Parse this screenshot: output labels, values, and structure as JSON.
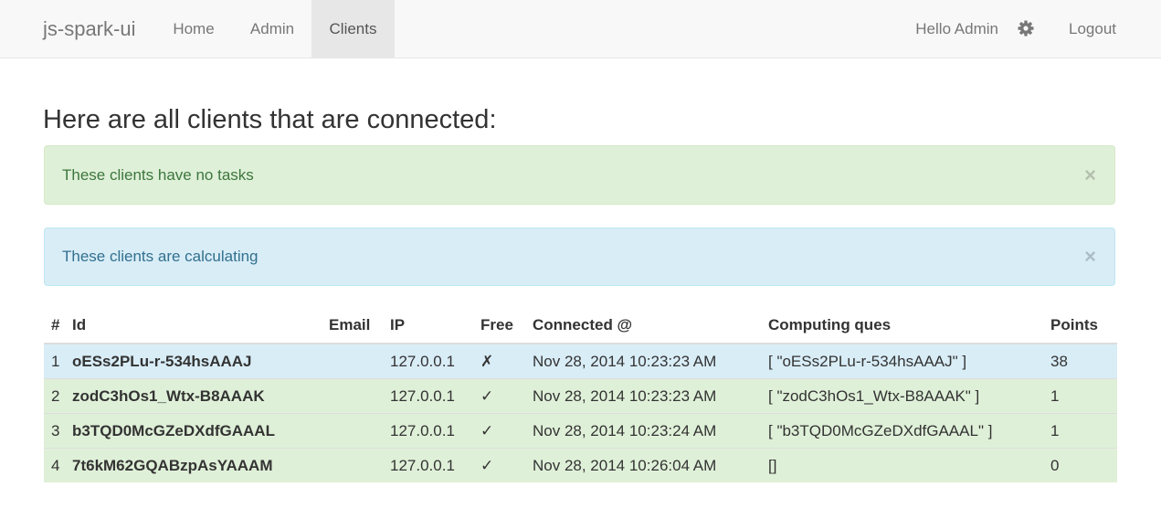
{
  "navbar": {
    "brand": "js-spark-ui",
    "tabs": [
      {
        "label": "Home"
      },
      {
        "label": "Admin"
      },
      {
        "label": "Clients",
        "active": true
      }
    ],
    "greeting": "Hello Admin",
    "settings_icon": "gear-icon",
    "logout_label": "Logout"
  },
  "page": {
    "title": "Here are all clients that are connected:"
  },
  "alerts": {
    "success": {
      "text": "These clients have no tasks",
      "close": "×"
    },
    "info": {
      "text": "These clients are calculating",
      "close": "×"
    }
  },
  "table": {
    "headers": {
      "num": "#",
      "id": "Id",
      "email": "Email",
      "ip": "IP",
      "free": "Free",
      "connected": "Connected @",
      "computing": "Computing ques",
      "points": "Points"
    },
    "rows": [
      {
        "num": "1",
        "id": "oESs2PLu-r-534hsAAAJ",
        "email": "",
        "ip": "127.0.0.1",
        "free": "✗",
        "connected": "Nov 28, 2014 10:23:23 AM",
        "computing": "[ \"oESs2PLu-r-534hsAAAJ\" ]",
        "points": "38",
        "status": "info"
      },
      {
        "num": "2",
        "id": "zodC3hOs1_Wtx-B8AAAK",
        "email": "",
        "ip": "127.0.0.1",
        "free": "✓",
        "connected": "Nov 28, 2014 10:23:23 AM",
        "computing": "[ \"zodC3hOs1_Wtx-B8AAAK\" ]",
        "points": "1",
        "status": "success"
      },
      {
        "num": "3",
        "id": "b3TQD0McGZeDXdfGAAAL",
        "email": "",
        "ip": "127.0.0.1",
        "free": "✓",
        "connected": "Nov 28, 2014 10:23:24 AM",
        "computing": "[ \"b3TQD0McGZeDXdfGAAAL\" ]",
        "points": "1",
        "status": "success"
      },
      {
        "num": "4",
        "id": "7t6kM62GQABzpAsYAAAM",
        "email": "",
        "ip": "127.0.0.1",
        "free": "✓",
        "connected": "Nov 28, 2014 10:26:04 AM",
        "computing": "[]",
        "points": "0",
        "status": "success"
      }
    ]
  },
  "colors": {
    "row_info": "#d9edf7",
    "row_success": "#dff0d8",
    "indicator": "#8fcb83"
  }
}
